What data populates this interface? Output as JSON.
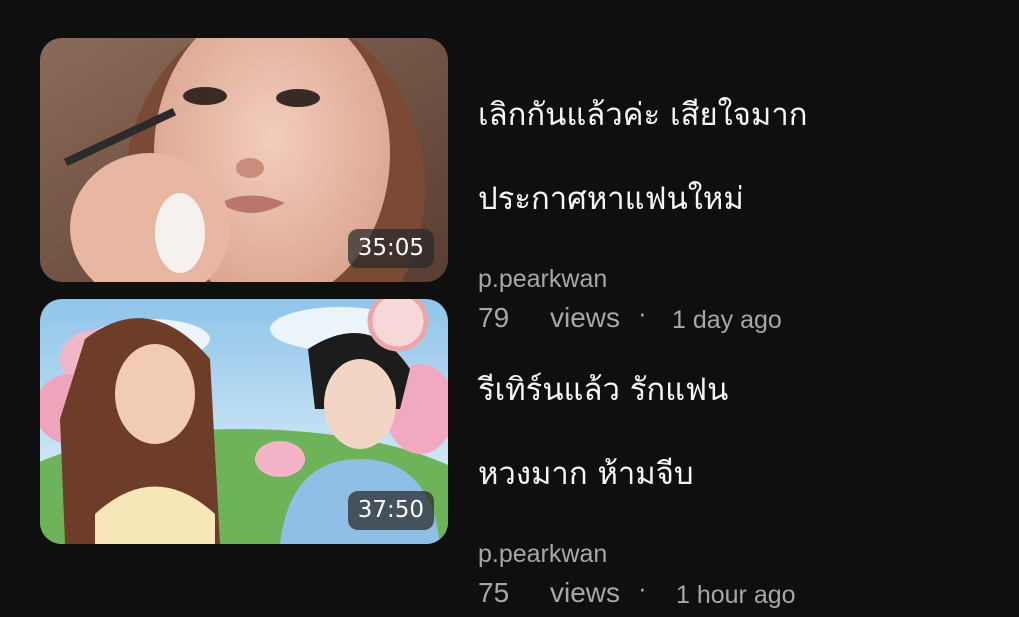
{
  "videos": [
    {
      "title_line1": "เลิกกันแล้วค่ะ เสียใจมาก",
      "title_line2": "ประกาศหาแฟนใหม่",
      "channel": "p.pearkwan",
      "views_count": "79",
      "views_label": "views",
      "separator": "·",
      "time_ago": "1 day ago",
      "duration": "35:05",
      "thumbnail_icon": "makeup-closeup-thumbnail"
    },
    {
      "title_line1": "รีเทิร์นแล้ว รักแฟน",
      "title_line2": "หวงมาก ห้ามจีบ",
      "channel": "p.pearkwan",
      "views_count": "75",
      "views_label": "views",
      "separator": "·",
      "time_ago": "1 hour ago",
      "duration": "37:50",
      "thumbnail_icon": "two-women-garden-thumbnail"
    }
  ]
}
